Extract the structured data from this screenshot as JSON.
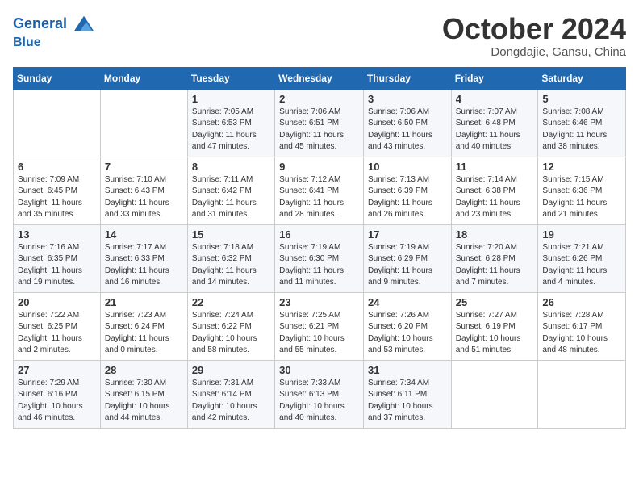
{
  "header": {
    "logo_line1": "General",
    "logo_line2": "Blue",
    "month": "October 2024",
    "location": "Dongdajie, Gansu, China"
  },
  "days_of_week": [
    "Sunday",
    "Monday",
    "Tuesday",
    "Wednesday",
    "Thursday",
    "Friday",
    "Saturday"
  ],
  "weeks": [
    [
      {
        "day": "",
        "sunrise": "",
        "sunset": "",
        "daylight": ""
      },
      {
        "day": "",
        "sunrise": "",
        "sunset": "",
        "daylight": ""
      },
      {
        "day": "1",
        "sunrise": "Sunrise: 7:05 AM",
        "sunset": "Sunset: 6:53 PM",
        "daylight": "Daylight: 11 hours and 47 minutes."
      },
      {
        "day": "2",
        "sunrise": "Sunrise: 7:06 AM",
        "sunset": "Sunset: 6:51 PM",
        "daylight": "Daylight: 11 hours and 45 minutes."
      },
      {
        "day": "3",
        "sunrise": "Sunrise: 7:06 AM",
        "sunset": "Sunset: 6:50 PM",
        "daylight": "Daylight: 11 hours and 43 minutes."
      },
      {
        "day": "4",
        "sunrise": "Sunrise: 7:07 AM",
        "sunset": "Sunset: 6:48 PM",
        "daylight": "Daylight: 11 hours and 40 minutes."
      },
      {
        "day": "5",
        "sunrise": "Sunrise: 7:08 AM",
        "sunset": "Sunset: 6:46 PM",
        "daylight": "Daylight: 11 hours and 38 minutes."
      }
    ],
    [
      {
        "day": "6",
        "sunrise": "Sunrise: 7:09 AM",
        "sunset": "Sunset: 6:45 PM",
        "daylight": "Daylight: 11 hours and 35 minutes."
      },
      {
        "day": "7",
        "sunrise": "Sunrise: 7:10 AM",
        "sunset": "Sunset: 6:43 PM",
        "daylight": "Daylight: 11 hours and 33 minutes."
      },
      {
        "day": "8",
        "sunrise": "Sunrise: 7:11 AM",
        "sunset": "Sunset: 6:42 PM",
        "daylight": "Daylight: 11 hours and 31 minutes."
      },
      {
        "day": "9",
        "sunrise": "Sunrise: 7:12 AM",
        "sunset": "Sunset: 6:41 PM",
        "daylight": "Daylight: 11 hours and 28 minutes."
      },
      {
        "day": "10",
        "sunrise": "Sunrise: 7:13 AM",
        "sunset": "Sunset: 6:39 PM",
        "daylight": "Daylight: 11 hours and 26 minutes."
      },
      {
        "day": "11",
        "sunrise": "Sunrise: 7:14 AM",
        "sunset": "Sunset: 6:38 PM",
        "daylight": "Daylight: 11 hours and 23 minutes."
      },
      {
        "day": "12",
        "sunrise": "Sunrise: 7:15 AM",
        "sunset": "Sunset: 6:36 PM",
        "daylight": "Daylight: 11 hours and 21 minutes."
      }
    ],
    [
      {
        "day": "13",
        "sunrise": "Sunrise: 7:16 AM",
        "sunset": "Sunset: 6:35 PM",
        "daylight": "Daylight: 11 hours and 19 minutes."
      },
      {
        "day": "14",
        "sunrise": "Sunrise: 7:17 AM",
        "sunset": "Sunset: 6:33 PM",
        "daylight": "Daylight: 11 hours and 16 minutes."
      },
      {
        "day": "15",
        "sunrise": "Sunrise: 7:18 AM",
        "sunset": "Sunset: 6:32 PM",
        "daylight": "Daylight: 11 hours and 14 minutes."
      },
      {
        "day": "16",
        "sunrise": "Sunrise: 7:19 AM",
        "sunset": "Sunset: 6:30 PM",
        "daylight": "Daylight: 11 hours and 11 minutes."
      },
      {
        "day": "17",
        "sunrise": "Sunrise: 7:19 AM",
        "sunset": "Sunset: 6:29 PM",
        "daylight": "Daylight: 11 hours and 9 minutes."
      },
      {
        "day": "18",
        "sunrise": "Sunrise: 7:20 AM",
        "sunset": "Sunset: 6:28 PM",
        "daylight": "Daylight: 11 hours and 7 minutes."
      },
      {
        "day": "19",
        "sunrise": "Sunrise: 7:21 AM",
        "sunset": "Sunset: 6:26 PM",
        "daylight": "Daylight: 11 hours and 4 minutes."
      }
    ],
    [
      {
        "day": "20",
        "sunrise": "Sunrise: 7:22 AM",
        "sunset": "Sunset: 6:25 PM",
        "daylight": "Daylight: 11 hours and 2 minutes."
      },
      {
        "day": "21",
        "sunrise": "Sunrise: 7:23 AM",
        "sunset": "Sunset: 6:24 PM",
        "daylight": "Daylight: 11 hours and 0 minutes."
      },
      {
        "day": "22",
        "sunrise": "Sunrise: 7:24 AM",
        "sunset": "Sunset: 6:22 PM",
        "daylight": "Daylight: 10 hours and 58 minutes."
      },
      {
        "day": "23",
        "sunrise": "Sunrise: 7:25 AM",
        "sunset": "Sunset: 6:21 PM",
        "daylight": "Daylight: 10 hours and 55 minutes."
      },
      {
        "day": "24",
        "sunrise": "Sunrise: 7:26 AM",
        "sunset": "Sunset: 6:20 PM",
        "daylight": "Daylight: 10 hours and 53 minutes."
      },
      {
        "day": "25",
        "sunrise": "Sunrise: 7:27 AM",
        "sunset": "Sunset: 6:19 PM",
        "daylight": "Daylight: 10 hours and 51 minutes."
      },
      {
        "day": "26",
        "sunrise": "Sunrise: 7:28 AM",
        "sunset": "Sunset: 6:17 PM",
        "daylight": "Daylight: 10 hours and 48 minutes."
      }
    ],
    [
      {
        "day": "27",
        "sunrise": "Sunrise: 7:29 AM",
        "sunset": "Sunset: 6:16 PM",
        "daylight": "Daylight: 10 hours and 46 minutes."
      },
      {
        "day": "28",
        "sunrise": "Sunrise: 7:30 AM",
        "sunset": "Sunset: 6:15 PM",
        "daylight": "Daylight: 10 hours and 44 minutes."
      },
      {
        "day": "29",
        "sunrise": "Sunrise: 7:31 AM",
        "sunset": "Sunset: 6:14 PM",
        "daylight": "Daylight: 10 hours and 42 minutes."
      },
      {
        "day": "30",
        "sunrise": "Sunrise: 7:33 AM",
        "sunset": "Sunset: 6:13 PM",
        "daylight": "Daylight: 10 hours and 40 minutes."
      },
      {
        "day": "31",
        "sunrise": "Sunrise: 7:34 AM",
        "sunset": "Sunset: 6:11 PM",
        "daylight": "Daylight: 10 hours and 37 minutes."
      },
      {
        "day": "",
        "sunrise": "",
        "sunset": "",
        "daylight": ""
      },
      {
        "day": "",
        "sunrise": "",
        "sunset": "",
        "daylight": ""
      }
    ]
  ]
}
